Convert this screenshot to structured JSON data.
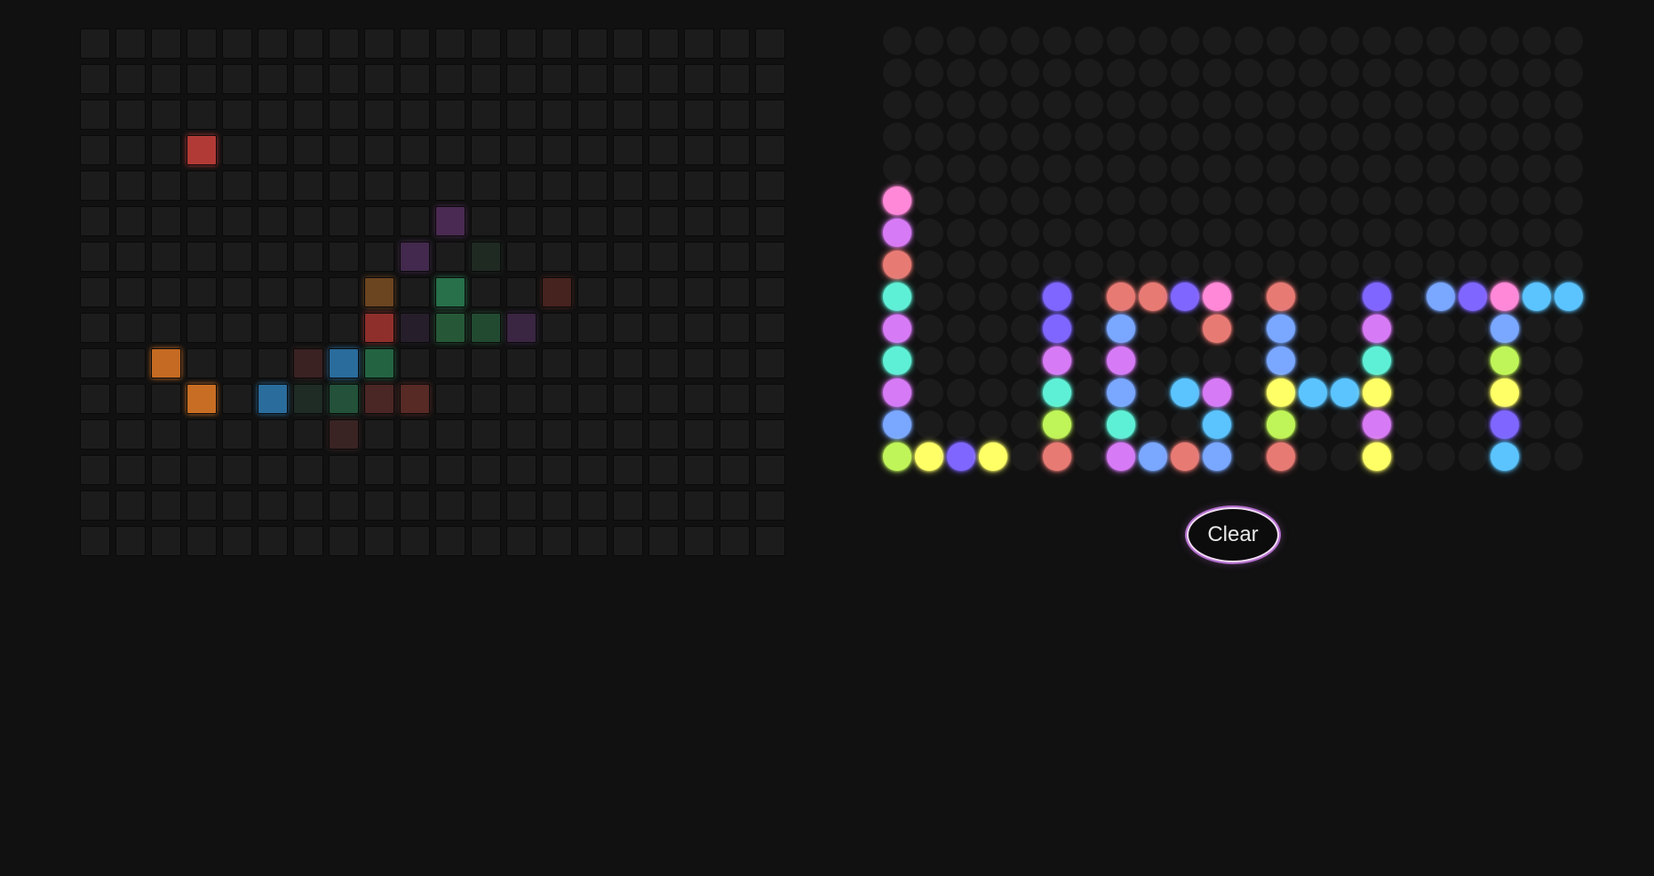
{
  "clear_button": {
    "label": "Clear"
  },
  "square_pads": {
    "columns": 20,
    "rows": 15,
    "off_color": "#1c1c1c",
    "lit": [
      {
        "row": 3,
        "col": 3,
        "color": "#b23a36"
      },
      {
        "row": 5,
        "col": 10,
        "color": "#4a2a52"
      },
      {
        "row": 6,
        "col": 9,
        "color": "#42294d"
      },
      {
        "row": 6,
        "col": 11,
        "color": "#1f2a22"
      },
      {
        "row": 7,
        "col": 8,
        "color": "#6b4420"
      },
      {
        "row": 7,
        "col": 10,
        "color": "#27704a"
      },
      {
        "row": 7,
        "col": 13,
        "color": "#46231f"
      },
      {
        "row": 8,
        "col": 8,
        "color": "#8f2f2c"
      },
      {
        "row": 8,
        "col": 9,
        "color": "#261f2b"
      },
      {
        "row": 8,
        "col": 10,
        "color": "#265838"
      },
      {
        "row": 8,
        "col": 11,
        "color": "#224a31"
      },
      {
        "row": 8,
        "col": 12,
        "color": "#3a2542"
      },
      {
        "row": 9,
        "col": 2,
        "color": "#c56a22"
      },
      {
        "row": 9,
        "col": 6,
        "color": "#3a2222"
      },
      {
        "row": 9,
        "col": 7,
        "color": "#2a6c9c"
      },
      {
        "row": 9,
        "col": 8,
        "color": "#236342"
      },
      {
        "row": 10,
        "col": 3,
        "color": "#c86e24"
      },
      {
        "row": 10,
        "col": 5,
        "color": "#2a6c9c"
      },
      {
        "row": 10,
        "col": 6,
        "color": "#1f2b25"
      },
      {
        "row": 10,
        "col": 7,
        "color": "#23513a"
      },
      {
        "row": 10,
        "col": 8,
        "color": "#4a2624"
      },
      {
        "row": 10,
        "col": 9,
        "color": "#572a25"
      },
      {
        "row": 11,
        "col": 7,
        "color": "#3a2323"
      }
    ]
  },
  "led_grid": {
    "columns": 22,
    "rows": 14,
    "off_color": "#1b1b1b",
    "lit": [
      {
        "row": 5,
        "col": 0,
        "color": "#ff88d8"
      },
      {
        "row": 6,
        "col": 0,
        "color": "#d77af5"
      },
      {
        "row": 7,
        "col": 0,
        "color": "#e87a74"
      },
      {
        "row": 8,
        "col": 0,
        "color": "#5ef0d6"
      },
      {
        "row": 9,
        "col": 0,
        "color": "#d77af5"
      },
      {
        "row": 10,
        "col": 0,
        "color": "#5ef0d6"
      },
      {
        "row": 11,
        "col": 0,
        "color": "#d77af5"
      },
      {
        "row": 12,
        "col": 0,
        "color": "#7aa7ff"
      },
      {
        "row": 13,
        "col": 0,
        "color": "#bff558"
      },
      {
        "row": 13,
        "col": 1,
        "color": "#ffff66"
      },
      {
        "row": 13,
        "col": 2,
        "color": "#7f66ff"
      },
      {
        "row": 13,
        "col": 3,
        "color": "#ffff66"
      },
      {
        "row": 8,
        "col": 5,
        "color": "#7f66ff"
      },
      {
        "row": 9,
        "col": 5,
        "color": "#7f66ff"
      },
      {
        "row": 10,
        "col": 5,
        "color": "#d77af5"
      },
      {
        "row": 11,
        "col": 5,
        "color": "#5ef0d6"
      },
      {
        "row": 12,
        "col": 5,
        "color": "#bff558"
      },
      {
        "row": 13,
        "col": 5,
        "color": "#e87a74"
      },
      {
        "row": 8,
        "col": 7,
        "color": "#e87a74"
      },
      {
        "row": 8,
        "col": 8,
        "color": "#e87a74"
      },
      {
        "row": 8,
        "col": 9,
        "color": "#7f66ff"
      },
      {
        "row": 8,
        "col": 10,
        "color": "#ff88d8"
      },
      {
        "row": 9,
        "col": 7,
        "color": "#7aa7ff"
      },
      {
        "row": 9,
        "col": 10,
        "color": "#e87a74"
      },
      {
        "row": 10,
        "col": 7,
        "color": "#d77af5"
      },
      {
        "row": 11,
        "col": 7,
        "color": "#7aa7ff"
      },
      {
        "row": 11,
        "col": 9,
        "color": "#5bc4ff"
      },
      {
        "row": 11,
        "col": 10,
        "color": "#d77af5"
      },
      {
        "row": 12,
        "col": 7,
        "color": "#5ef0d6"
      },
      {
        "row": 12,
        "col": 10,
        "color": "#5bc4ff"
      },
      {
        "row": 13,
        "col": 7,
        "color": "#d77af5"
      },
      {
        "row": 13,
        "col": 8,
        "color": "#7aa7ff"
      },
      {
        "row": 13,
        "col": 9,
        "color": "#e87a74"
      },
      {
        "row": 13,
        "col": 10,
        "color": "#7aa7ff"
      },
      {
        "row": 8,
        "col": 12,
        "color": "#e87a74"
      },
      {
        "row": 9,
        "col": 12,
        "color": "#7aa7ff"
      },
      {
        "row": 10,
        "col": 12,
        "color": "#7aa7ff"
      },
      {
        "row": 11,
        "col": 12,
        "color": "#ffff66"
      },
      {
        "row": 11,
        "col": 13,
        "color": "#5bc4ff"
      },
      {
        "row": 11,
        "col": 14,
        "color": "#5bc4ff"
      },
      {
        "row": 12,
        "col": 12,
        "color": "#bff558"
      },
      {
        "row": 13,
        "col": 12,
        "color": "#e87a74"
      },
      {
        "row": 8,
        "col": 15,
        "color": "#7f66ff"
      },
      {
        "row": 9,
        "col": 15,
        "color": "#d77af5"
      },
      {
        "row": 10,
        "col": 15,
        "color": "#5ef0d6"
      },
      {
        "row": 11,
        "col": 15,
        "color": "#ffff66"
      },
      {
        "row": 12,
        "col": 15,
        "color": "#d77af5"
      },
      {
        "row": 13,
        "col": 15,
        "color": "#ffff66"
      },
      {
        "row": 8,
        "col": 17,
        "color": "#7aa7ff"
      },
      {
        "row": 8,
        "col": 18,
        "color": "#7f66ff"
      },
      {
        "row": 8,
        "col": 19,
        "color": "#ff88d8"
      },
      {
        "row": 8,
        "col": 20,
        "color": "#5bc4ff"
      },
      {
        "row": 8,
        "col": 21,
        "color": "#5bc4ff"
      },
      {
        "row": 9,
        "col": 19,
        "color": "#7aa7ff"
      },
      {
        "row": 10,
        "col": 19,
        "color": "#bff558"
      },
      {
        "row": 11,
        "col": 19,
        "color": "#ffff66"
      },
      {
        "row": 12,
        "col": 19,
        "color": "#7f66ff"
      },
      {
        "row": 13,
        "col": 19,
        "color": "#5bc4ff"
      }
    ]
  }
}
